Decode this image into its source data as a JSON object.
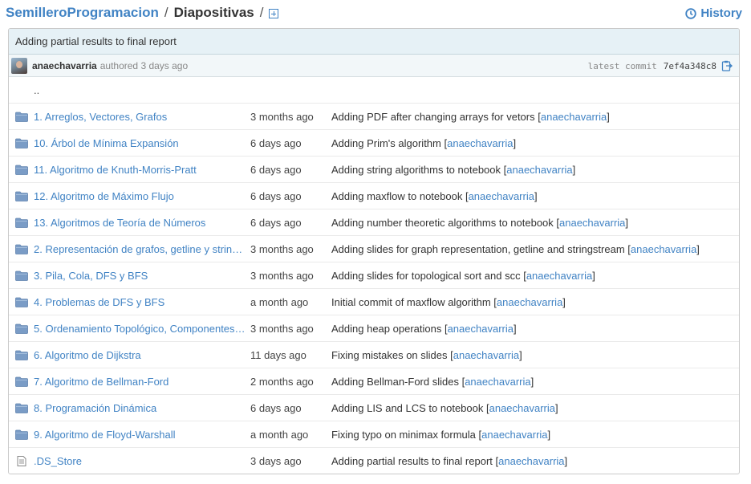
{
  "breadcrumb": {
    "repo": "SemilleroProgramacion",
    "separator": "/",
    "current": "Diapositivas"
  },
  "history_label": "History",
  "commit": {
    "title": "Adding partial results to final report",
    "author": "anaechavarria",
    "authored_text": "authored 3 days ago",
    "latest_label": "latest commit",
    "sha": "7ef4a348c8"
  },
  "parent_dir": "..",
  "files": [
    {
      "type": "folder",
      "name": "1. Arreglos, Vectores, Grafos",
      "age": "3 months ago",
      "message": "Adding PDF after changing arrays for vetors",
      "author": "anaechavarria"
    },
    {
      "type": "folder",
      "name": "10. Árbol de Mínima Expansión",
      "age": "6 days ago",
      "message": "Adding Prim's algorithm",
      "author": "anaechavarria"
    },
    {
      "type": "folder",
      "name": "11. Algoritmo de Knuth-Morris-Pratt",
      "age": "6 days ago",
      "message": "Adding string algorithms to notebook",
      "author": "anaechavarria"
    },
    {
      "type": "folder",
      "name": "12. Algoritmo de Máximo Flujo",
      "age": "6 days ago",
      "message": "Adding maxflow to notebook",
      "author": "anaechavarria"
    },
    {
      "type": "folder",
      "name": "13. Algoritmos de Teoría de Números",
      "age": "6 days ago",
      "message": "Adding number theoretic algorithms to notebook",
      "author": "anaechavarria"
    },
    {
      "type": "folder",
      "name": "2. Representación de grafos, getline y strin…",
      "age": "3 months ago",
      "message": "Adding slides for graph representation, getline and stringstream",
      "author": "anaechavarria"
    },
    {
      "type": "folder",
      "name": "3. Pila, Cola, DFS y BFS",
      "age": "3 months ago",
      "message": "Adding slides for topological sort and scc",
      "author": "anaechavarria"
    },
    {
      "type": "folder",
      "name": "4. Problemas de DFS y BFS",
      "age": "a month ago",
      "message": "Initial commit of maxflow algorithm",
      "author": "anaechavarria"
    },
    {
      "type": "folder",
      "name": "5. Ordenamiento Topológico, Componentes…",
      "age": "3 months ago",
      "message": "Adding heap operations",
      "author": "anaechavarria"
    },
    {
      "type": "folder",
      "name": "6. Algoritmo de Dijkstra",
      "age": "11 days ago",
      "message": "Fixing mistakes on slides",
      "author": "anaechavarria"
    },
    {
      "type": "folder",
      "name": "7. Algoritmo de Bellman-Ford",
      "age": "2 months ago",
      "message": "Adding Bellman-Ford slides",
      "author": "anaechavarria"
    },
    {
      "type": "folder",
      "name": "8. Programación Dinámica",
      "age": "6 days ago",
      "message": "Adding LIS and LCS to notebook",
      "author": "anaechavarria"
    },
    {
      "type": "folder",
      "name": "9. Algoritmo de Floyd-Warshall",
      "age": "a month ago",
      "message": "Fixing typo on minimax formula",
      "author": "anaechavarria"
    },
    {
      "type": "file",
      "name": ".DS_Store",
      "age": "3 days ago",
      "message": "Adding partial results to final report",
      "author": "anaechavarria"
    }
  ],
  "colors": {
    "link": "#4183c4",
    "commit_bar": "#e6f1f6",
    "folder_icon": "#7a9cc6"
  }
}
